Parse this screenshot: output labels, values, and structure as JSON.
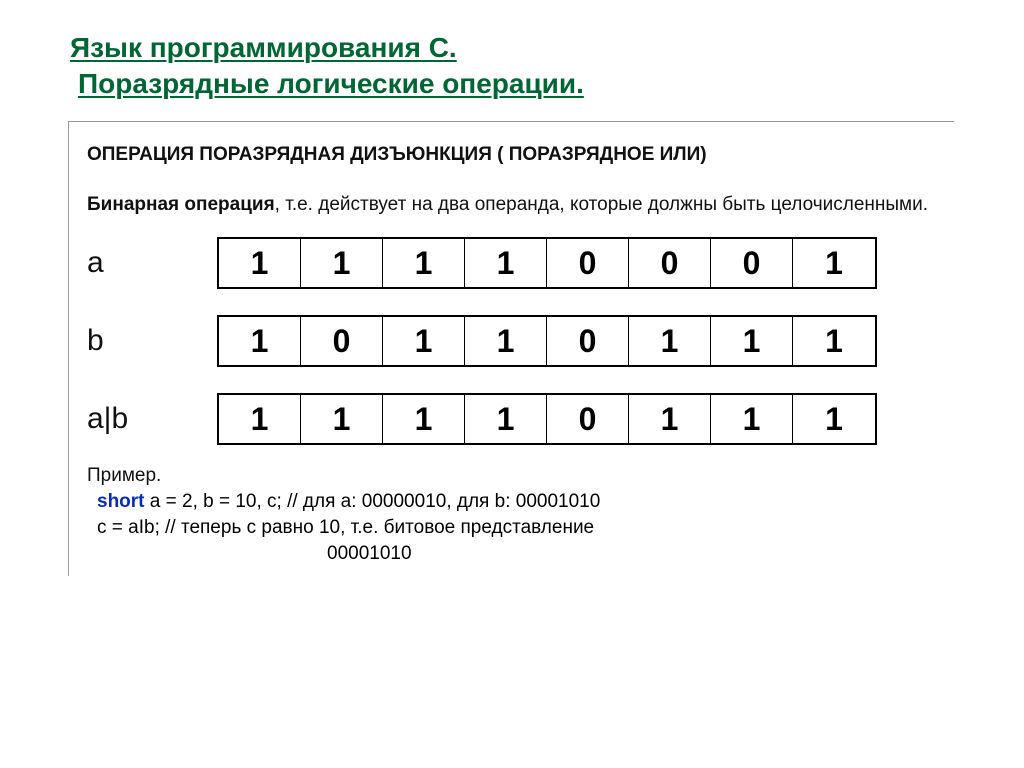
{
  "heading": {
    "line1": "Язык программирования С.",
    "line2": "Поразрядные логические операции."
  },
  "operation": {
    "title": "ОПЕРАЦИЯ ПОРАЗРЯДНАЯ ДИЗЪЮНКЦИЯ ( ПОРАЗРЯДНОЕ ИЛИ)",
    "desc_bold": "Бинарная операция",
    "desc_rest": ", т.е. действует на два операнда, которые должны быть целочисленными."
  },
  "rows": {
    "a_label": "a",
    "b_label": "b",
    "ab_label": "a|b",
    "a": [
      "1",
      "1",
      "1",
      "1",
      "0",
      "0",
      "0",
      "1"
    ],
    "b": [
      "1",
      "0",
      "1",
      "1",
      "0",
      "1",
      "1",
      "1"
    ],
    "ab": [
      "1",
      "1",
      "1",
      "1",
      "0",
      "1",
      "1",
      "1"
    ]
  },
  "example": {
    "label": "Пример.",
    "kw": "short",
    "line1_rest": " a = 2, b = 10, c; // для a: 00000010, для b: 00001010",
    "line2": " c = aIb;                         // теперь с равно 10, т.е. битовое представление",
    "line3": "00001010"
  }
}
